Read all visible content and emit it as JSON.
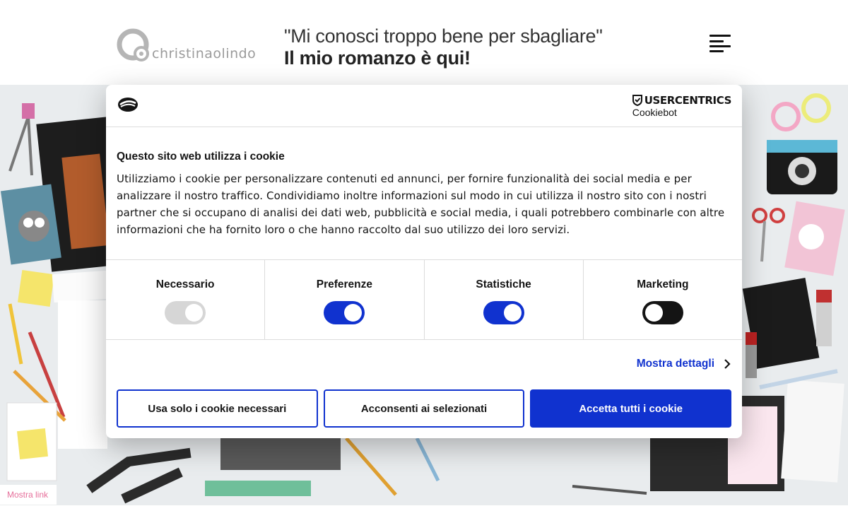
{
  "header": {
    "logo_text": "christinaolindo",
    "tagline_quote": "\"Mi conosci troppo bene per sbagliare\"",
    "tagline_sub": "Il mio romanzo è qui!"
  },
  "cookie_dialog": {
    "brand_main": "USERCENTRICS",
    "brand_sub": "Cookiebot",
    "title": "Questo sito web utilizza i cookie",
    "text": "Utilizziamo i cookie per personalizzare contenuti ed annunci, per fornire funzionalità dei social media e per analizzare il nostro traffico. Condividiamo inoltre informazioni sul modo in cui utilizza il nostro sito con i nostri partner che si occupano di analisi dei dati web, pubblicità e social media, i quali potrebbero combinarle con altre informazioni che ha fornito loro o che hanno raccolto dal suo utilizzo dei loro servizi.",
    "toggles": [
      {
        "label": "Necessario",
        "state": "disabled-on"
      },
      {
        "label": "Preferenze",
        "state": "on"
      },
      {
        "label": "Statistiche",
        "state": "on"
      },
      {
        "label": "Marketing",
        "state": "off"
      }
    ],
    "details_link": "Mostra dettagli",
    "buttons": {
      "necessary": "Usa solo i cookie necessari",
      "selected": "Acconsenti ai selezionati",
      "accept_all": "Accetta tutti i cookie"
    },
    "accent_color": "#1032cf"
  },
  "footer": {
    "show_link": "Mostra link"
  }
}
